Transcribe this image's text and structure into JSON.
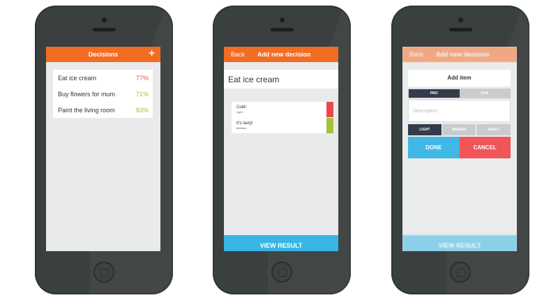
{
  "colors": {
    "brand_orange": "#f26c24",
    "accent_blue": "#39b5e4",
    "bad_red": "#e84a4a",
    "good_green": "#a4c23a",
    "dark_navy": "#343b4a"
  },
  "phone1": {
    "nav": {
      "title": "Decisions",
      "add_icon": "+"
    },
    "decisions": [
      {
        "label": "Eat ice cream",
        "percent": "77%",
        "color": "#e5524f"
      },
      {
        "label": "Buy flowers for mum",
        "percent": "71%",
        "color": "#a4c23a"
      },
      {
        "label": "Paint the living room",
        "percent": "83%",
        "color": "#a4c23a"
      }
    ]
  },
  "phone2": {
    "nav": {
      "back": "Back",
      "title": "Add new decision"
    },
    "decision_title": "Eat ice cream",
    "items": [
      {
        "name": "Cold!",
        "weight": "Light",
        "color": "#e84a4a"
      },
      {
        "name": "It's tasty!",
        "weight": "Medium",
        "color": "#a4c23a"
      }
    ],
    "view_result": "VIEW RESULT"
  },
  "phone3": {
    "nav": {
      "back": "Back",
      "title": "Add new decision"
    },
    "view_result": "VIEW RESULT",
    "modal": {
      "title": "Add item",
      "type_options": {
        "pro": "PRO",
        "con": "CON"
      },
      "selected_type": "PRO",
      "description_placeholder": "Description",
      "weights": {
        "light": "LIGHT",
        "medium": "MEDIUM",
        "heavy": "HEAVY"
      },
      "selected_weight": "LIGHT",
      "done": "DONE",
      "cancel": "CANCEL"
    }
  }
}
